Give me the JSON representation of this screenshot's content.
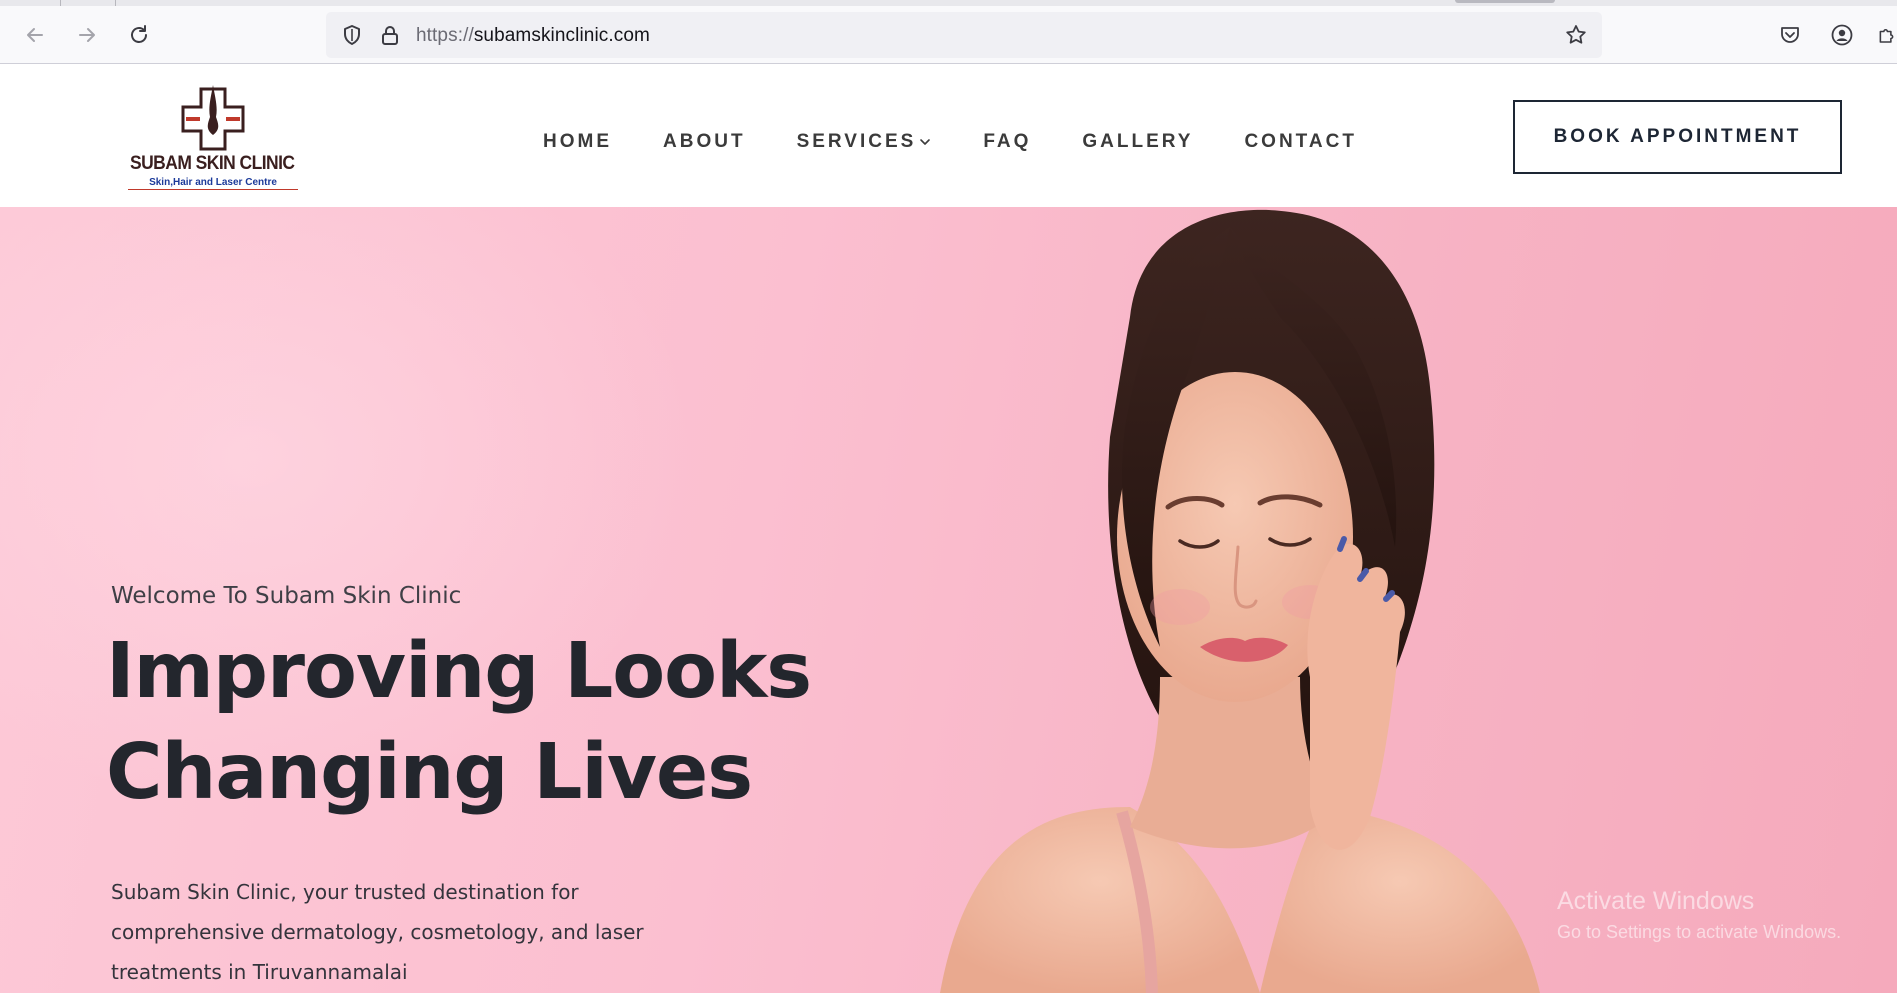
{
  "browser": {
    "url_scheme": "https://",
    "url_host": "subamskinclinic.com",
    "icons": [
      "back-icon",
      "forward-icon",
      "reload-icon",
      "shield-icon",
      "lock-icon",
      "bookmark-star-icon",
      "pocket-icon",
      "account-icon",
      "extensions-icon"
    ]
  },
  "header": {
    "logo": {
      "name": "SUBAM SKIN CLINIC",
      "tagline": "Skin,Hair and Laser Centre"
    },
    "nav": {
      "home": "HOME",
      "about": "ABOUT",
      "services": "SERVICES",
      "faq": "FAQ",
      "gallery": "GALLERY",
      "contact": "CONTACT"
    },
    "book_button": "BOOK APPOINTMENT"
  },
  "hero": {
    "welcome": "Welcome To Subam Skin Clinic",
    "title_line1": "Improving Looks",
    "title_line2": "Changing Lives",
    "description": "Subam Skin Clinic, your trusted destination for comprehensive dermatology, cosmetology, and laser treatments in Tiruvannamalai"
  },
  "os_watermark": {
    "title": "Activate Windows",
    "subtitle": "Go to Settings to activate Windows."
  },
  "colors": {
    "hero_pink": "#fbbfd0",
    "heading_dark": "#23262d",
    "logo_brown": "#3a1f1f",
    "logo_blue": "#1b3a9a"
  }
}
